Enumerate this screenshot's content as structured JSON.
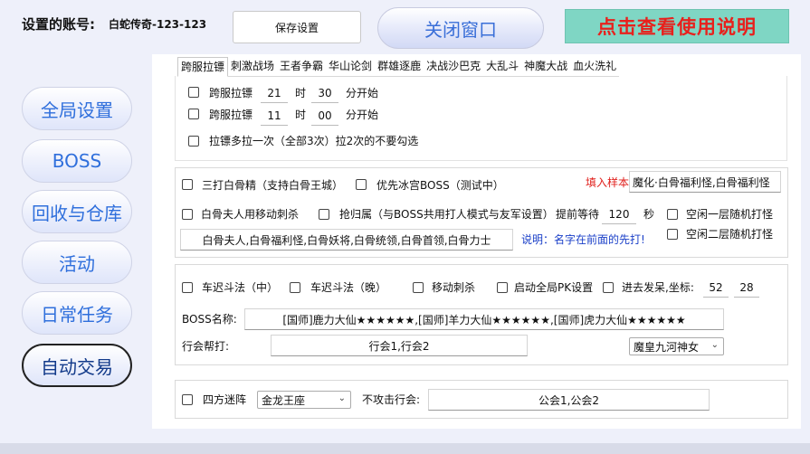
{
  "header": {
    "account_label": "设置的账号:",
    "account_name": "白蛇传奇-123-123",
    "save_label": "保存设置",
    "close_label": "关闭窗口",
    "help_label": "点击查看使用说明"
  },
  "sidebar": {
    "items": [
      {
        "label": "全局设置"
      },
      {
        "label": "BOSS"
      },
      {
        "label": "回收与仓库"
      },
      {
        "label": "活动"
      },
      {
        "label": "日常任务"
      },
      {
        "label": "自动交易"
      }
    ]
  },
  "tabs": [
    {
      "label": "跨服拉镖"
    },
    {
      "label": "刺激战场"
    },
    {
      "label": "王者争霸"
    },
    {
      "label": "华山论剑"
    },
    {
      "label": "群雄逐鹿"
    },
    {
      "label": "决战沙巴克"
    },
    {
      "label": "大乱斗"
    },
    {
      "label": "神魔大战"
    },
    {
      "label": "血火洗礼"
    }
  ],
  "escort": {
    "row1": {
      "label": "跨服拉镖",
      "hour": "21",
      "hour_unit": "时",
      "minute": "30",
      "minute_unit": "分开始"
    },
    "row2": {
      "label": "跨服拉镖",
      "hour": "11",
      "hour_unit": "时",
      "minute": "00",
      "minute_unit": "分开始"
    },
    "note": "拉镖多拉一次（全部3次）拉2次的不要勾选"
  },
  "bone": {
    "cb_triple": "三打白骨精（支持白骨王城）",
    "cb_ice": "优先冰宫BOSS（测试中）",
    "sample_label": "填入样本",
    "sample_value": "魔化·白骨福利怪,白骨福利怪",
    "cb_lady": "白骨夫人用移动刺杀",
    "cb_grab": "抢归属（与BOSS共用打人模式与友军设置）",
    "wait_label": "提前等待",
    "wait_value": "120",
    "wait_unit": "秒",
    "cb_idle1": "空闲一层随机打怪",
    "cb_idle2": "空闲二层随机打怪",
    "target_list": "白骨夫人,白骨福利怪,白骨妖将,白骨统领,白骨首领,白骨力士",
    "note": "说明：名字在前面的先打!"
  },
  "chechi": {
    "cb_mid": "车迟斗法（中）",
    "cb_night": "车迟斗法（晚）",
    "cb_move": "移动刺杀",
    "cb_pk": "启动全局PK设置",
    "cb_idle": "进去发呆,坐标:",
    "coord_x": "52",
    "coord_y": "28",
    "boss_label": "BOSS名称:",
    "boss_value": "[国师]鹿力大仙★★★★★★,[国师]羊力大仙★★★★★★,[国师]虎力大仙★★★★★★",
    "guild_label": "行会帮打:",
    "guild_value": "行会1,行会2",
    "server_select": "魔皇九河神女"
  },
  "maze": {
    "cb_maze": "四方迷阵",
    "seat_select": "金龙王座",
    "no_attack_label": "不攻击行会:",
    "no_attack_value": "公会1,公会2"
  }
}
